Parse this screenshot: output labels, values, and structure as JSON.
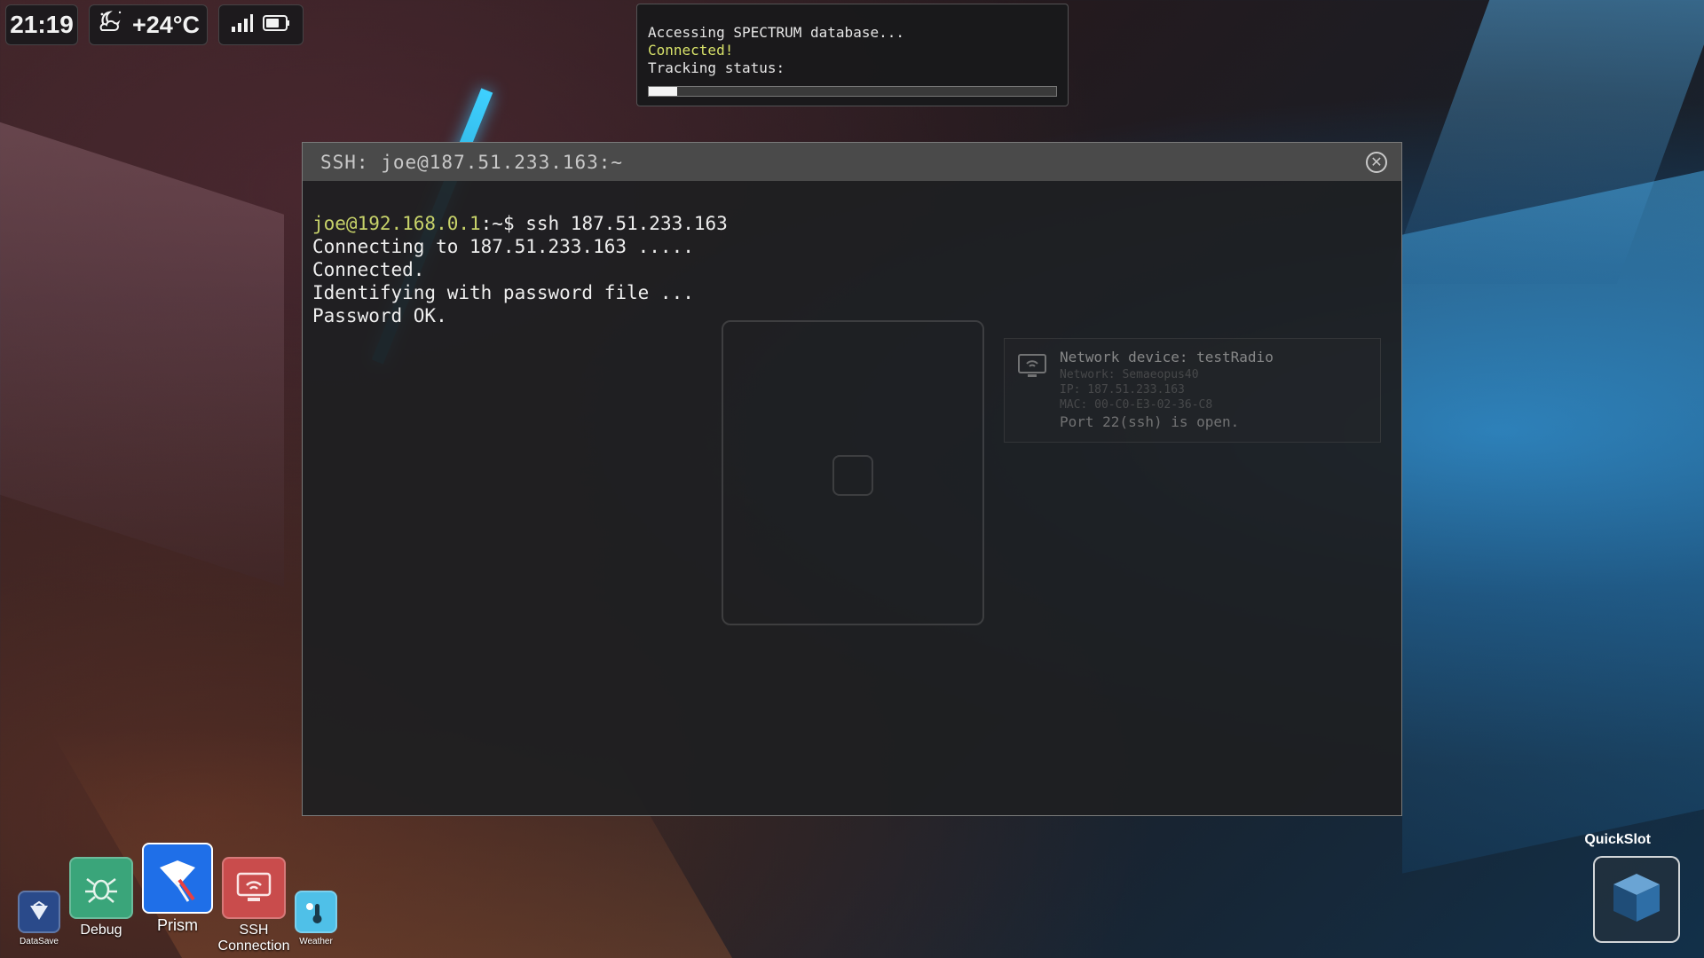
{
  "status_bar": {
    "clock": "21:19",
    "weather": {
      "temperature": "+24°C",
      "icon": "moon-cloud-icon"
    },
    "network": {
      "signal_icon": "signal-bars-icon",
      "battery_icon": "battery-icon"
    }
  },
  "notification": {
    "line1": "Accessing SPECTRUM database...",
    "line2": "Connected!",
    "line3": "Tracking status:",
    "progress_fraction": 0.07,
    "colors": {
      "connected": "#d8e26a"
    }
  },
  "ssh_window": {
    "title": "SSH: joe@187.51.233.163:~",
    "close_icon": "close-circle-icon",
    "terminal": {
      "prompt_user": "joe@192.168.0.1",
      "prompt_suffix": ":~$ ssh 187.51.233.163",
      "lines": [
        "Connecting to 187.51.233.163 .....",
        "Connected.",
        "Identifying with password file ...",
        "Password OK."
      ]
    },
    "device_info": {
      "title": "Network device: testRadio",
      "network": "Network: Semaeopus40",
      "ip": "IP: 187.51.233.163",
      "mac": "MAC: 00-C0-E3-02-36-C8",
      "port": "Port 22(ssh) is open."
    }
  },
  "dock": [
    {
      "label": "DataSave",
      "icon": "datasave-icon",
      "color": "#2a4a8a"
    },
    {
      "label": "Debug",
      "icon": "debug-bug-icon",
      "color": "#3aa57a"
    },
    {
      "label": "Prism",
      "icon": "prism-icon",
      "color": "#1f6fe8"
    },
    {
      "label": "SSH\nConnection",
      "icon": "ssh-monitor-icon",
      "color": "#c94c4c"
    },
    {
      "label": "Weather",
      "icon": "weather-icon",
      "color": "#4fc0e8"
    }
  ],
  "quickslot": {
    "label": "QuickSlot",
    "icon": "cube-icon"
  }
}
